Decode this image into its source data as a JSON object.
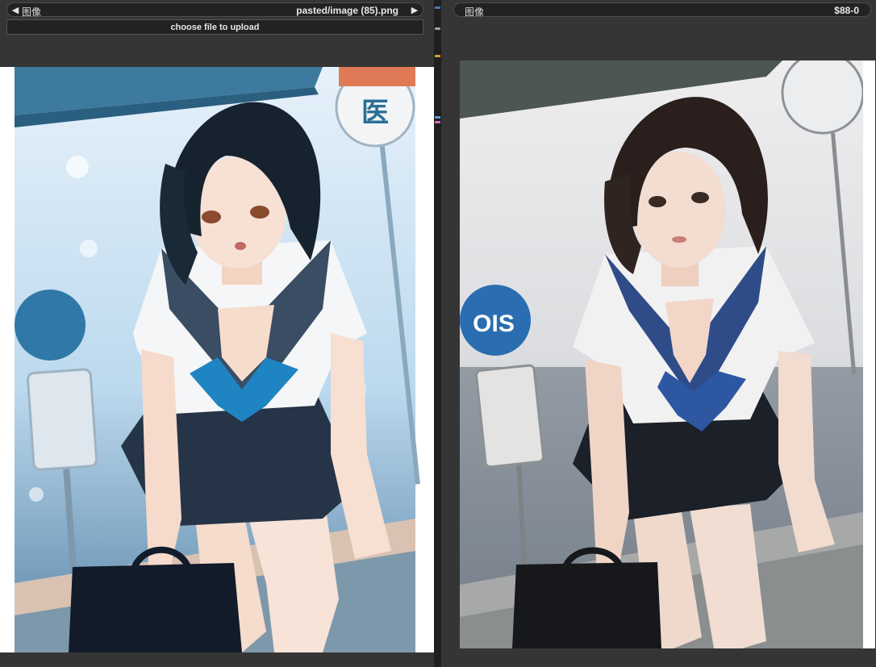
{
  "left_node": {
    "widget_label": "图像",
    "widget_value": "pasted/image (85).png",
    "prev_icon": "triangle-left-icon",
    "next_icon": "triangle-right-icon",
    "upload_label": "choose file to upload",
    "illustration_sign_text": "医"
  },
  "right_node": {
    "widget_label": "图像",
    "widget_value": "$88-0",
    "photo_sign_text": "OIS"
  },
  "colors": {
    "background": "#353535",
    "widget_bg": "#222222",
    "divider": "#1f1f1f",
    "link_orange": "#e0a030",
    "link_pink": "#d070c0",
    "link_blue": "#60a0e0"
  }
}
